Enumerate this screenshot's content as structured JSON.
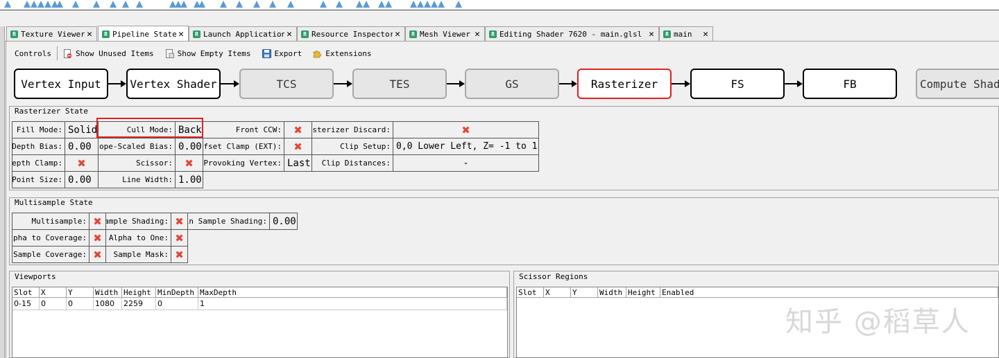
{
  "tabs": [
    {
      "label": "Texture Viewer",
      "active": false
    },
    {
      "label": "Pipeline State",
      "active": true
    },
    {
      "label": "Launch Application",
      "active": false
    },
    {
      "label": "Resource Inspector",
      "active": false
    },
    {
      "label": "Mesh Viewer",
      "active": false
    },
    {
      "label": "Editing Shader 7620 - main.glsl -…",
      "active": false
    },
    {
      "label": "main",
      "active": false
    }
  ],
  "tab_close_glyph": "✕",
  "tab_icon_glyph": "R",
  "toolbar": {
    "controls": "Controls",
    "show_unused": "Show Unused Items",
    "show_empty": "Show Empty Items",
    "export": "Export",
    "extensions": "Extensions"
  },
  "pipeline": {
    "stages": [
      {
        "label": "Vertex Input",
        "state": "enabled"
      },
      {
        "label": "Vertex Shader",
        "state": "enabled"
      },
      {
        "label": "TCS",
        "state": "disabled"
      },
      {
        "label": "TES",
        "state": "disabled"
      },
      {
        "label": "GS",
        "state": "disabled"
      },
      {
        "label": "Rasterizer",
        "state": "selected"
      },
      {
        "label": "FS",
        "state": "enabled"
      },
      {
        "label": "FB",
        "state": "enabled"
      },
      {
        "label": "Compute Shader",
        "state": "disabled"
      }
    ]
  },
  "rasterizer": {
    "title": "Rasterizer State",
    "fill_mode_label": "Fill Mode:",
    "fill_mode": "Solid",
    "cull_mode_label": "Cull Mode:",
    "cull_mode": "Back",
    "front_ccw_label": "Front CCW:",
    "front_ccw": "✖",
    "raster_discard_label": "Rasterizer Discard:",
    "raster_discard": "✖",
    "depth_bias_label": "Depth Bias:",
    "depth_bias": "0.00",
    "slope_bias_label": "Slope-Scaled Bias:",
    "slope_bias": "0.00",
    "offset_clamp_label": "Offset Clamp (EXT):",
    "offset_clamp": "✖",
    "clip_setup_label": "Clip Setup:",
    "clip_setup": "0,0 Lower Left, Z= -1 to 1",
    "depth_clamp_label": "Depth Clamp:",
    "depth_clamp": "✖",
    "scissor_label": "Scissor:",
    "scissor": "✖",
    "provoking_vertex_label": "Provoking Vertex:",
    "provoking_vertex": "Last",
    "clip_distances_label": "Clip Distances:",
    "clip_distances": "-",
    "point_size_label": "Point Size:",
    "point_size": "0.00",
    "line_width_label": "Line Width:",
    "line_width": "1.00"
  },
  "multisample": {
    "title": "Multisample State",
    "multisample_label": "Multisample:",
    "multisample": "✖",
    "sample_shading_label": "Sample Shading:",
    "sample_shading": "✖",
    "min_sample_shading_label": "Min Sample Shading:",
    "min_sample_shading": "0.00",
    "alpha_to_coverage_label": "Alpha to Coverage:",
    "alpha_to_coverage": "✖",
    "alpha_to_one_label": "Alpha to One:",
    "alpha_to_one": "✖",
    "sample_coverage_label": "Sample Coverage:",
    "sample_coverage": "✖",
    "sample_mask_label": "Sample Mask:",
    "sample_mask": "✖"
  },
  "viewports": {
    "title": "Viewports",
    "columns": [
      "Slot",
      "X",
      "Y",
      "Width",
      "Height",
      "MinDepth",
      "MaxDepth"
    ],
    "rows": [
      [
        "0-15",
        "0",
        "0",
        "1080",
        "2259",
        "0",
        "1"
      ]
    ]
  },
  "scissors": {
    "title": "Scissor Regions",
    "columns": [
      "Slot",
      "X",
      "Y",
      "Width",
      "Height",
      "Enabled"
    ],
    "rows": []
  },
  "watermark": "知乎 @稻草人",
  "colors": {
    "accent_red": "#e02020",
    "cross": "#e0473a",
    "tab_icon": "#2e9b6b",
    "top_triangles": "#5b9bd5"
  }
}
